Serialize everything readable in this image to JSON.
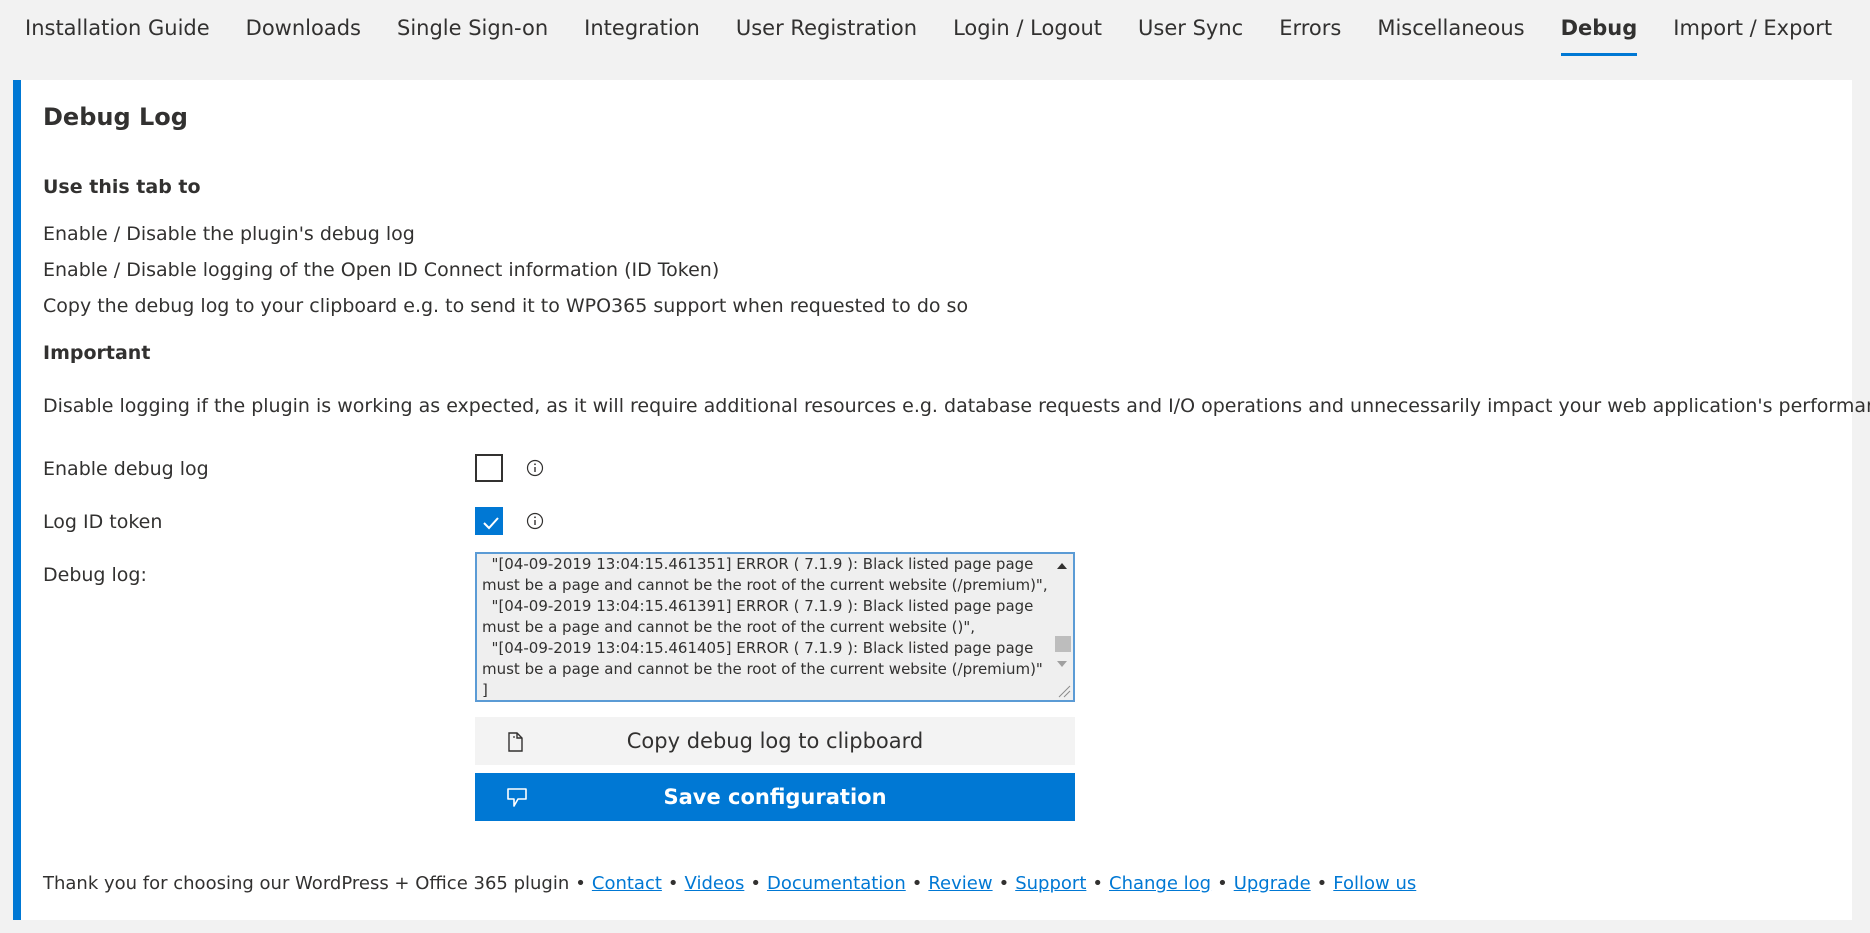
{
  "tabs": [
    {
      "label": "Installation Guide",
      "active": false
    },
    {
      "label": "Downloads",
      "active": false
    },
    {
      "label": "Single Sign-on",
      "active": false
    },
    {
      "label": "Integration",
      "active": false
    },
    {
      "label": "User Registration",
      "active": false
    },
    {
      "label": "Login / Logout",
      "active": false
    },
    {
      "label": "User Sync",
      "active": false
    },
    {
      "label": "Errors",
      "active": false
    },
    {
      "label": "Miscellaneous",
      "active": false
    },
    {
      "label": "Debug",
      "active": true
    },
    {
      "label": "Import / Export",
      "active": false
    }
  ],
  "panel": {
    "title": "Debug Log",
    "intro_heading": "Use this tab to",
    "items": [
      "Enable / Disable the plugin's debug log",
      "Enable / Disable logging of the Open ID Connect information (ID Token)",
      "Copy the debug log to your clipboard e.g. to send it to WPO365 support when requested to do so"
    ],
    "important_heading": "Important",
    "important_text": "Disable logging if the plugin is working as expected, as it will require additional resources e.g. database requests and I/O operations and unnecessarily impact your web application's performance."
  },
  "form": {
    "enable_debug_label": "Enable debug log",
    "enable_debug_checked": false,
    "log_id_token_label": "Log ID token",
    "log_id_token_checked": true,
    "debug_log_label": "Debug log:",
    "debug_log_value": "  \"[04-09-2019 13:04:15.461351] ERROR ( 7.1.9 ): Black listed page page must be a page and cannot be the root of the current website (/premium)\",\n  \"[04-09-2019 13:04:15.461391] ERROR ( 7.1.9 ): Black listed page page must be a page and cannot be the root of the current website ()\",\n  \"[04-09-2019 13:04:15.461405] ERROR ( 7.1.9 ): Black listed page page must be a page and cannot be the root of the current website (/premium)\"\n]",
    "copy_button": "Copy debug log to clipboard",
    "save_button": "Save configuration"
  },
  "footer": {
    "text": "Thank you for choosing our WordPress + Office 365 plugin",
    "links": [
      "Contact",
      "Videos",
      "Documentation",
      "Review",
      "Support",
      "Change log",
      "Upgrade",
      "Follow us"
    ]
  },
  "colors": {
    "accent": "#0078d4"
  },
  "icons": {
    "info": "info-icon",
    "copy": "copy-icon",
    "save": "thumbs-down-icon",
    "check": "check-icon"
  }
}
